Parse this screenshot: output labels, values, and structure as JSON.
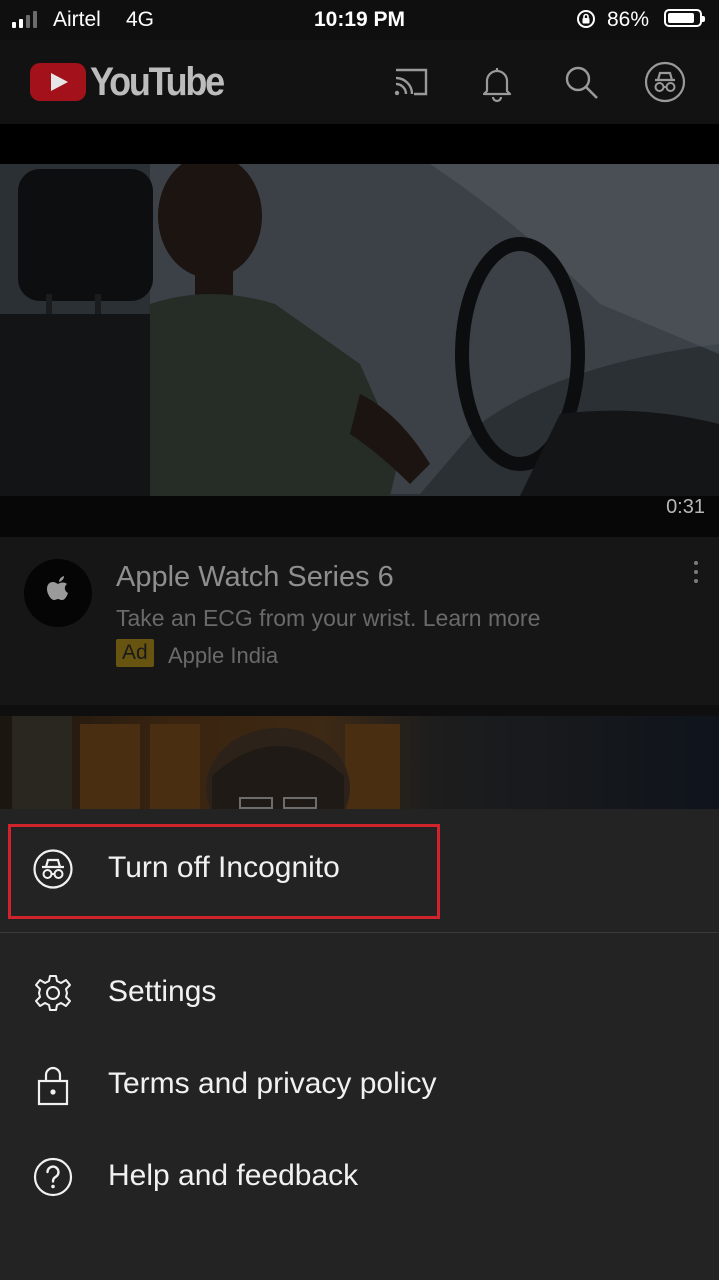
{
  "status_bar": {
    "carrier": "Airtel",
    "network": "4G",
    "time": "10:19 PM",
    "battery_percent_label": "86%",
    "battery_level": 0.86,
    "signal_bars_active": 2,
    "signal_bars_total": 4
  },
  "app_bar": {
    "logo_text": "YouTube",
    "icons": [
      "cast-icon",
      "notifications-bell-icon",
      "search-icon",
      "incognito-icon"
    ]
  },
  "feed": {
    "video_duration": "0:31",
    "ad": {
      "title": "Apple Watch Series 6",
      "description": "Take an ECG from your wrist. Learn more",
      "badge": "Ad",
      "advertiser": "Apple India",
      "avatar_icon": "apple-logo-icon"
    }
  },
  "menu_sheet": {
    "items": [
      {
        "label": "Turn off Incognito",
        "icon": "incognito-icon"
      },
      {
        "label": "Settings",
        "icon": "gear-icon"
      },
      {
        "label": "Terms and privacy policy",
        "icon": "lock-icon"
      },
      {
        "label": "Help and feedback",
        "icon": "help-icon"
      }
    ]
  },
  "colors": {
    "background": "#0f0f0f",
    "sheet": "#232323",
    "highlight": "#d0232b",
    "youtube_red": "#a3121b",
    "ad_badge": "#675410"
  }
}
